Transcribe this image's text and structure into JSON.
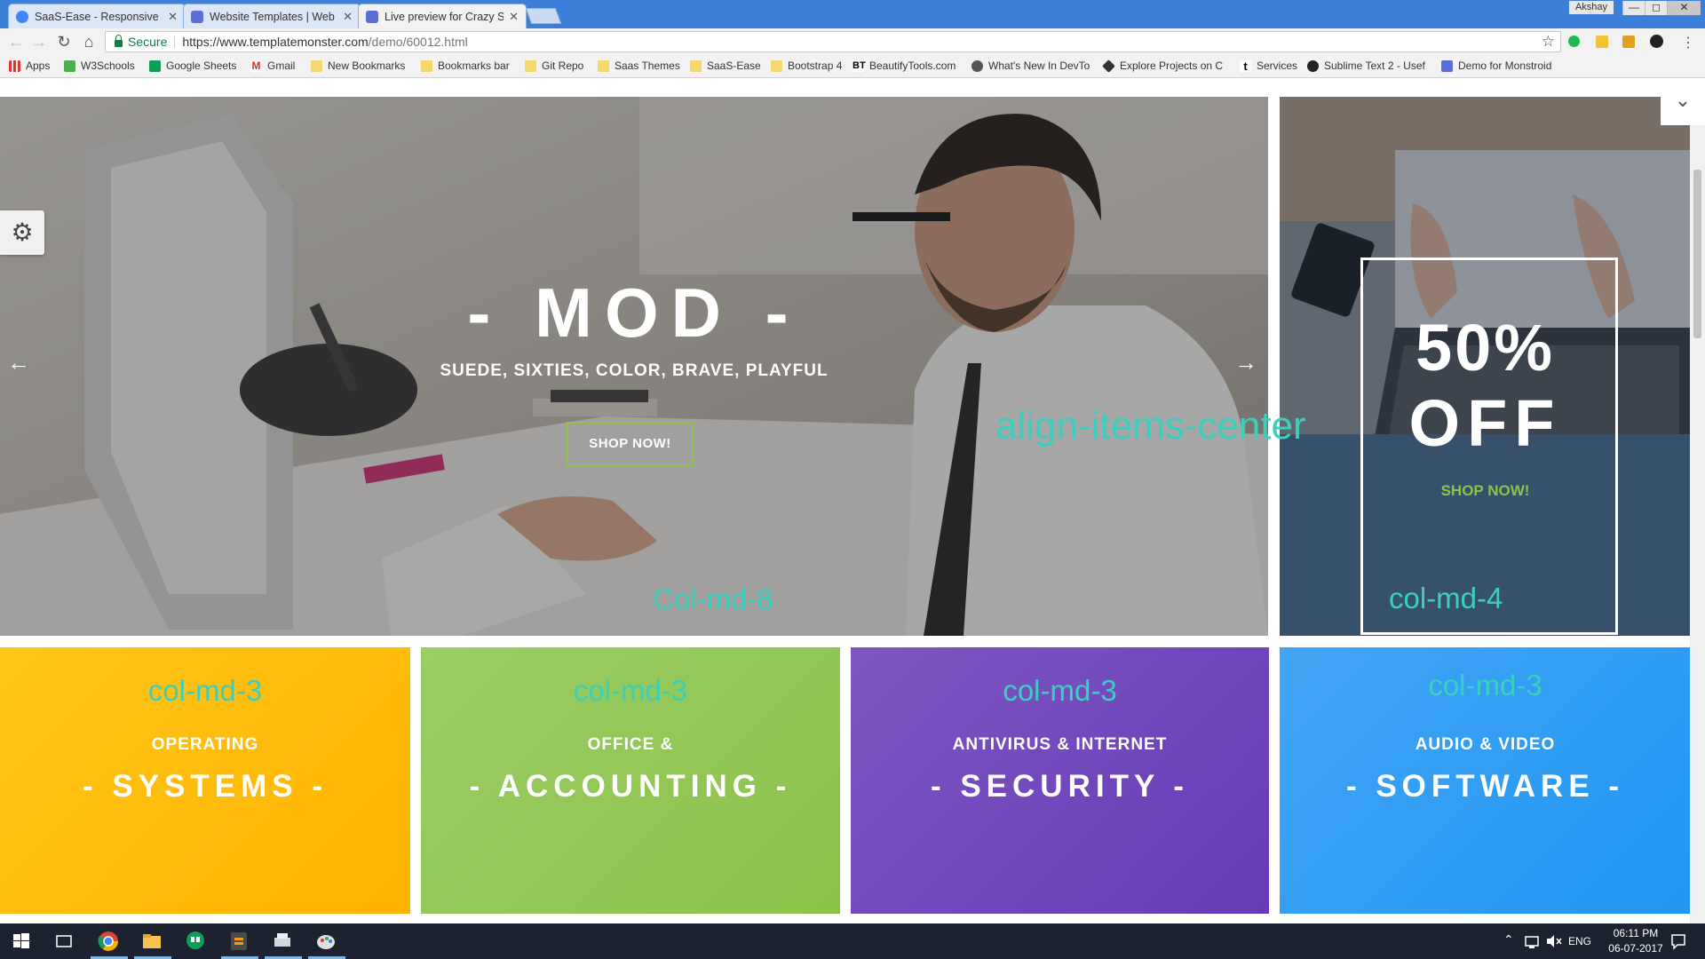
{
  "colors": {
    "titlebar": "#3b7fd9",
    "green_accent": "#8bc34a",
    "annotation": "#3ad0c0",
    "yellow": "#ffc107",
    "green": "#8bc34a",
    "purple": "#673ab7",
    "blue": "#2196f3"
  },
  "tabs": [
    {
      "label": "SaaS-Ease - Responsive S",
      "icon": "chrome-icon"
    },
    {
      "label": "Website Templates | Web",
      "icon": "templatemonster-icon"
    },
    {
      "label": "Live preview for Crazy Sc",
      "icon": "templatemonster-icon"
    }
  ],
  "window": {
    "user": "Akshay",
    "min": "—",
    "max": "◻",
    "close": "✕"
  },
  "toolbar": {
    "secure": "Secure",
    "url_host": "https://www.templatemonster.com",
    "url_path": "/demo/60012.html"
  },
  "bookmarks": [
    {
      "label": "Apps",
      "icon": "apps-grid-icon"
    },
    {
      "label": "W3Schools",
      "icon": "w3schools-icon"
    },
    {
      "label": "Google Sheets",
      "icon": "sheets-icon"
    },
    {
      "label": "Gmail",
      "icon": "gmail-icon"
    },
    {
      "label": "New Bookmarks",
      "icon": "folder-icon"
    },
    {
      "label": "Bookmarks bar",
      "icon": "folder-icon"
    },
    {
      "label": "Git Repo",
      "icon": "folder-icon"
    },
    {
      "label": "Saas Themes",
      "icon": "folder-icon"
    },
    {
      "label": "SaaS-Ease",
      "icon": "folder-icon"
    },
    {
      "label": "Bootstrap 4",
      "icon": "folder-icon"
    },
    {
      "label": "BeautifyTools.com",
      "icon": "bt-icon"
    },
    {
      "label": "What's New In DevTo",
      "icon": "devtools-icon"
    },
    {
      "label": "Explore Projects on C",
      "icon": "codepen-icon"
    },
    {
      "label": "Services",
      "icon": "t-icon"
    },
    {
      "label": "Sublime Text 2 - Usef",
      "icon": "github-icon"
    },
    {
      "label": "Demo for Monstroid",
      "icon": "monstroid-icon"
    }
  ],
  "hero": {
    "title": "- MOD -",
    "subtitle": "SUEDE, SIXTIES, COLOR, BRAVE, PLAYFUL",
    "button": "SHOP NOW!",
    "prev": "←",
    "next": "→",
    "annotation": "Col-md-8"
  },
  "side": {
    "percent": "50%",
    "off": "OFF",
    "button": "SHOP NOW!",
    "annotation": "col-md-4"
  },
  "overlay_annotation": "align-items-center",
  "categories": [
    {
      "line1": "OPERATING",
      "line2": "- SYSTEMS -",
      "annotation": "col-md-3"
    },
    {
      "line1": "OFFICE &",
      "line2": "- ACCOUNTING -",
      "annotation": "col-md-3"
    },
    {
      "line1": "ANTIVIRUS & INTERNET",
      "line2": "- SECURITY -",
      "annotation": "col-md-3"
    },
    {
      "line1": "AUDIO & VIDEO",
      "line2": "- SOFTWARE  -",
      "annotation": "col-md-3"
    }
  ],
  "taskbar": {
    "lang": "ENG",
    "time": "06:11 PM",
    "date": "06-07-2017"
  }
}
